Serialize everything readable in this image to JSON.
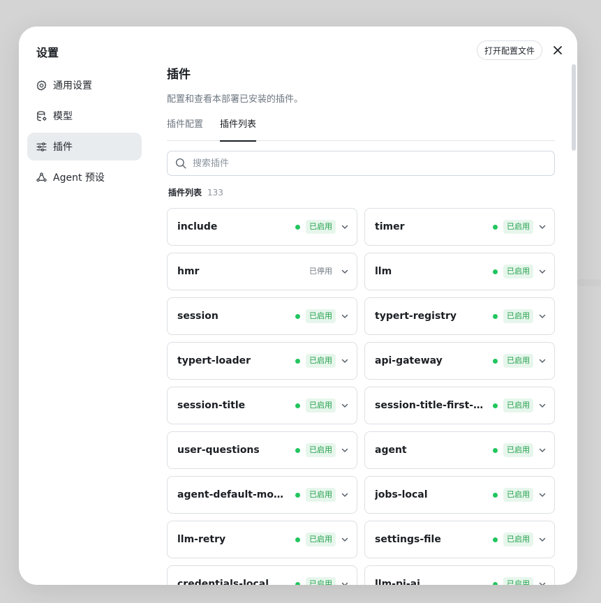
{
  "dialog": {
    "title": "设置",
    "open_config_label": "打开配置文件"
  },
  "sidebar": {
    "items": [
      {
        "label": "通用设置",
        "icon": "gear-icon",
        "active": false
      },
      {
        "label": "模型",
        "icon": "database-icon",
        "active": false
      },
      {
        "label": "插件",
        "icon": "sliders-icon",
        "active": true
      },
      {
        "label": "Agent 预设",
        "icon": "agent-icon",
        "active": false
      }
    ]
  },
  "main": {
    "title": "插件",
    "description": "配置和查看本部署已安装的插件。",
    "tabs": [
      {
        "label": "插件配置",
        "active": false
      },
      {
        "label": "插件列表",
        "active": true
      }
    ],
    "search_placeholder": "搜索插件",
    "list_title": "插件列表",
    "list_count": "133"
  },
  "status_colors": {
    "enabled_dot": "#22c55e",
    "enabled_text": "#22a04b",
    "enabled_bg": "#e7f6ec"
  },
  "plugins": [
    {
      "name": "include",
      "status": "已启用",
      "enabled": true
    },
    {
      "name": "timer",
      "status": "已启用",
      "enabled": true
    },
    {
      "name": "hmr",
      "status": "已停用",
      "enabled": false
    },
    {
      "name": "llm",
      "status": "已启用",
      "enabled": true
    },
    {
      "name": "session",
      "status": "已启用",
      "enabled": true
    },
    {
      "name": "typert-registry",
      "status": "已启用",
      "enabled": true
    },
    {
      "name": "typert-loader",
      "status": "已启用",
      "enabled": true
    },
    {
      "name": "api-gateway",
      "status": "已启用",
      "enabled": true
    },
    {
      "name": "session-title",
      "status": "已启用",
      "enabled": true
    },
    {
      "name": "session-title-first-prompt",
      "status": "已启用",
      "enabled": true
    },
    {
      "name": "user-questions",
      "status": "已启用",
      "enabled": true
    },
    {
      "name": "agent",
      "status": "已启用",
      "enabled": true
    },
    {
      "name": "agent-default-model",
      "status": "已启用",
      "enabled": true
    },
    {
      "name": "jobs-local",
      "status": "已启用",
      "enabled": true
    },
    {
      "name": "llm-retry",
      "status": "已启用",
      "enabled": true
    },
    {
      "name": "settings-file",
      "status": "已启用",
      "enabled": true
    },
    {
      "name": "credentials-local",
      "status": "已启用",
      "enabled": true
    },
    {
      "name": "llm-pi-ai",
      "status": "已启用",
      "enabled": true
    }
  ]
}
